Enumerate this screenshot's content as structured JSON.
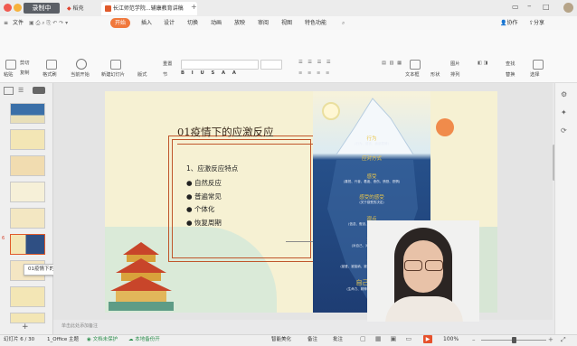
{
  "window": {
    "recording_label": "录制中",
    "tabs": [
      "稻壳",
      "长江师范学院...辅康教育讲稿",
      "+"
    ],
    "colors": {
      "accent": "#f0783c",
      "slide_bg": "#f6f1d3",
      "iceberg_sea": "#1e3d73",
      "frame": "#c0562b"
    }
  },
  "menu": {
    "file": "文件",
    "items": [
      "开始",
      "插入",
      "设计",
      "切换",
      "动画",
      "放映",
      "审阅",
      "视图",
      "特色功能"
    ],
    "right": [
      "分享",
      "协作"
    ]
  },
  "toolbar": {
    "cut": "剪切",
    "copy": "复制",
    "paste": "粘贴",
    "format_painter": "格式刷",
    "from_current": "当前开始",
    "new_slide": "新建幻灯片",
    "layout": "版式",
    "section": "节",
    "reset": "重置",
    "text_box": "文本框",
    "shape": "形状",
    "arrange": "排列",
    "picture": "图片",
    "find": "查找",
    "replace": "替换",
    "select": "选择"
  },
  "thumbnails": {
    "count_shown": 9,
    "current": "6",
    "tooltip": "01疫情下的应激反应"
  },
  "slide": {
    "title": "01疫情下的应激反应",
    "subtitle": "1、应激反应特点",
    "bullets": [
      "自然反应",
      "普遍常见",
      "个体化",
      "恢复周期"
    ],
    "iceberg": {
      "tiers": [
        {
          "title": "行为",
          "sub": "(行为、语言、面部表情)"
        },
        {
          "title": "应对方式",
          "sub": ""
        },
        {
          "title": "感受",
          "sub": "(喜悦、兴奋、着迷、悲伤、愤怒、恐惧)"
        },
        {
          "title": "感受的感受",
          "sub": "(关于感受的决定)"
        },
        {
          "title": "观点",
          "sub": "(信念、假设、思维模式、价值观)"
        },
        {
          "title": "期待",
          "sub": "(对自己、对别人、来自他人)"
        },
        {
          "title": "渴望",
          "sub": "(被爱、被接纳、被认可、价值、意义、自由)"
        },
        {
          "title": "自己：我是",
          "sub": "(生命力、精神、灵性、核心、本质)"
        }
      ]
    }
  },
  "notes_placeholder": "单击此处添加备注",
  "status": {
    "slide_counter": "幻灯片 6 / 30",
    "theme": "1_Office 主题",
    "doc_protect": "文档未保护",
    "backup": "本地备份开",
    "smart_beautify": "智能美化",
    "notes": "备注",
    "comments": "批注",
    "zoom": "100%"
  }
}
